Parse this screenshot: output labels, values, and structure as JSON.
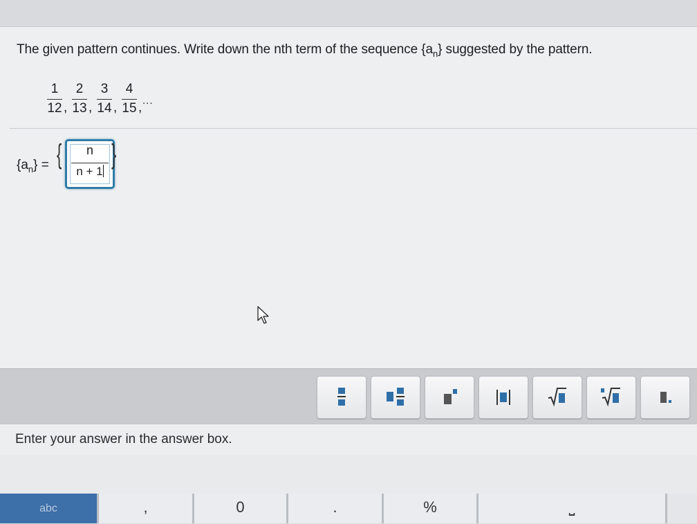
{
  "question": {
    "text_before": "The given pattern continues. Write down the nth term of the sequence {a",
    "subscript": "n",
    "text_after": "} suggested by the pattern."
  },
  "sequence": {
    "terms": [
      {
        "num": "1",
        "den": "12"
      },
      {
        "num": "2",
        "den": "13"
      },
      {
        "num": "3",
        "den": "14"
      },
      {
        "num": "4",
        "den": "15"
      }
    ],
    "separator": ",",
    "ellipsis": "..."
  },
  "answer": {
    "lhs_open": "{a",
    "lhs_sub": "n",
    "lhs_close": "} =",
    "numerator": "n",
    "denominator": "n + 1"
  },
  "toolbar": {
    "buttons": [
      {
        "icon": "fraction-icon"
      },
      {
        "icon": "mixed-number-icon"
      },
      {
        "icon": "exponent-icon"
      },
      {
        "icon": "absolute-value-icon"
      },
      {
        "icon": "square-root-icon"
      },
      {
        "icon": "nth-root-icon"
      },
      {
        "icon": "decimal-icon"
      }
    ],
    "accent": "#2f6fa8"
  },
  "status": {
    "message": "Enter your answer in the answer box."
  },
  "keyboard": {
    "keys": [
      "abc",
      ",",
      "0",
      ".",
      "%",
      "⎵"
    ]
  }
}
